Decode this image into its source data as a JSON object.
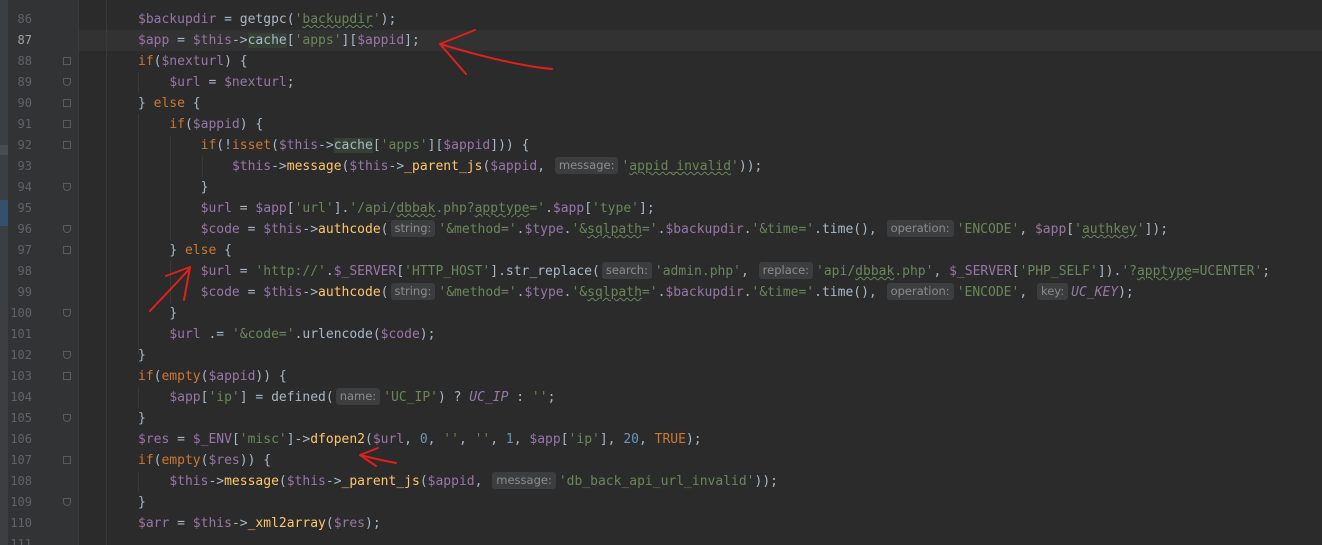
{
  "editor": {
    "current_line": "87",
    "lines": [
      {
        "num": "86",
        "segments": [
          [
            "v",
            "$backupdir"
          ],
          [
            "p",
            " = getgpc("
          ],
          [
            "s",
            "'"
          ],
          [
            "s typo",
            "backupdir"
          ],
          [
            "s",
            "'"
          ],
          [
            "p",
            ");"
          ]
        ]
      },
      {
        "num": "87",
        "segments": [
          [
            "v",
            "$app"
          ],
          [
            "p",
            " = "
          ],
          [
            "v",
            "$this"
          ],
          [
            "p",
            "->"
          ],
          [
            "p hl",
            "cache"
          ],
          [
            "p",
            "["
          ],
          [
            "s",
            "'apps'"
          ],
          [
            "p",
            "]["
          ],
          [
            "v",
            "$appid"
          ],
          [
            "p",
            "];"
          ]
        ]
      },
      {
        "num": "88",
        "segments": [
          [
            "k",
            "if"
          ],
          [
            "p",
            "("
          ],
          [
            "v",
            "$nexturl"
          ],
          [
            "p",
            ") {"
          ]
        ]
      },
      {
        "num": "89",
        "segments": [
          [
            "v",
            "$url"
          ],
          [
            "p",
            " = "
          ],
          [
            "v",
            "$nexturl"
          ],
          [
            "p",
            ";"
          ]
        ]
      },
      {
        "num": "90",
        "segments": [
          [
            "p",
            "} "
          ],
          [
            "k",
            "else"
          ],
          [
            "p",
            " {"
          ]
        ]
      },
      {
        "num": "91",
        "segments": [
          [
            "k",
            "if"
          ],
          [
            "p",
            "("
          ],
          [
            "v",
            "$appid"
          ],
          [
            "p",
            ") {"
          ]
        ]
      },
      {
        "num": "92",
        "segments": [
          [
            "k",
            "if"
          ],
          [
            "p",
            "(!"
          ],
          [
            "k",
            "isset"
          ],
          [
            "p",
            "("
          ],
          [
            "v",
            "$this"
          ],
          [
            "p",
            "->"
          ],
          [
            "p hl",
            "cache"
          ],
          [
            "p",
            "["
          ],
          [
            "s",
            "'apps'"
          ],
          [
            "p",
            "]["
          ],
          [
            "v",
            "$appid"
          ],
          [
            "p",
            "])) {"
          ]
        ]
      },
      {
        "num": "93",
        "segments": [
          [
            "v",
            "$this"
          ],
          [
            "p",
            "->"
          ],
          [
            "f",
            "message"
          ],
          [
            "p",
            "("
          ],
          [
            "v",
            "$this"
          ],
          [
            "p",
            "->"
          ],
          [
            "f",
            "_parent_js"
          ],
          [
            "p",
            "("
          ],
          [
            "v",
            "$appid"
          ],
          [
            "p",
            ", "
          ],
          [
            "hint",
            "message:"
          ],
          [
            "s",
            "'"
          ],
          [
            "s typo",
            "appid_invalid"
          ],
          [
            "s",
            "'"
          ],
          [
            "p",
            "));"
          ]
        ]
      },
      {
        "num": "94",
        "segments": [
          [
            "p",
            "}"
          ]
        ]
      },
      {
        "num": "95",
        "segments": [
          [
            "v",
            "$url"
          ],
          [
            "p",
            " = "
          ],
          [
            "v",
            "$app"
          ],
          [
            "p",
            "["
          ],
          [
            "s",
            "'url'"
          ],
          [
            "p",
            "]."
          ],
          [
            "s",
            "'/api/"
          ],
          [
            "s typo",
            "dbbak"
          ],
          [
            "s",
            ".php?"
          ],
          [
            "s typo",
            "apptype"
          ],
          [
            "s",
            "='"
          ],
          [
            "p",
            "."
          ],
          [
            "v",
            "$app"
          ],
          [
            "p",
            "["
          ],
          [
            "s",
            "'type'"
          ],
          [
            "p",
            "];"
          ]
        ]
      },
      {
        "num": "96",
        "segments": [
          [
            "v",
            "$code"
          ],
          [
            "p",
            " = "
          ],
          [
            "v",
            "$this"
          ],
          [
            "p",
            "->"
          ],
          [
            "f",
            "authcode"
          ],
          [
            "p",
            "("
          ],
          [
            "hint",
            "string:"
          ],
          [
            "s",
            "'&method='"
          ],
          [
            "p",
            "."
          ],
          [
            "v",
            "$type"
          ],
          [
            "p",
            "."
          ],
          [
            "s",
            "'&"
          ],
          [
            "s typo",
            "sqlpath"
          ],
          [
            "s",
            "='"
          ],
          [
            "p",
            "."
          ],
          [
            "v",
            "$backupdir"
          ],
          [
            "p",
            "."
          ],
          [
            "s",
            "'&time='"
          ],
          [
            "p",
            ".time(), "
          ],
          [
            "hint",
            "operation:"
          ],
          [
            "s",
            "'ENCODE'"
          ],
          [
            "p",
            ", "
          ],
          [
            "v",
            "$app"
          ],
          [
            "p",
            "["
          ],
          [
            "s",
            "'"
          ],
          [
            "s typo",
            "authkey"
          ],
          [
            "s",
            "'"
          ],
          [
            "p",
            "]);"
          ]
        ]
      },
      {
        "num": "97",
        "segments": [
          [
            "p",
            "} "
          ],
          [
            "k",
            "else"
          ],
          [
            "p",
            " {"
          ]
        ]
      },
      {
        "num": "98",
        "segments": [
          [
            "v",
            "$url"
          ],
          [
            "p",
            " = "
          ],
          [
            "s",
            "'http://'"
          ],
          [
            "p",
            "."
          ],
          [
            "v",
            "$_SERVER"
          ],
          [
            "p",
            "["
          ],
          [
            "s",
            "'HTTP_HOST'"
          ],
          [
            "p",
            "].str_replace("
          ],
          [
            "hint",
            "search:"
          ],
          [
            "s",
            "'admin.php'"
          ],
          [
            "p",
            ", "
          ],
          [
            "hint",
            "replace:"
          ],
          [
            "s",
            "'api/"
          ],
          [
            "s typo",
            "dbbak"
          ],
          [
            "s",
            ".php'"
          ],
          [
            "p",
            ", "
          ],
          [
            "v",
            "$_SERVER"
          ],
          [
            "p",
            "["
          ],
          [
            "s",
            "'PHP_SELF'"
          ],
          [
            "p",
            "])."
          ],
          [
            "s",
            "'?"
          ],
          [
            "s typo",
            "apptype"
          ],
          [
            "s",
            "=UCENTER'"
          ],
          [
            "p",
            ";"
          ]
        ]
      },
      {
        "num": "99",
        "segments": [
          [
            "v",
            "$code"
          ],
          [
            "p",
            " = "
          ],
          [
            "v",
            "$this"
          ],
          [
            "p",
            "->"
          ],
          [
            "f",
            "authcode"
          ],
          [
            "p",
            "("
          ],
          [
            "hint",
            "string:"
          ],
          [
            "s",
            "'&method='"
          ],
          [
            "p",
            "."
          ],
          [
            "v",
            "$type"
          ],
          [
            "p",
            "."
          ],
          [
            "s",
            "'&"
          ],
          [
            "s typo",
            "sqlpath"
          ],
          [
            "s",
            "='"
          ],
          [
            "p",
            "."
          ],
          [
            "v",
            "$backupdir"
          ],
          [
            "p",
            "."
          ],
          [
            "s",
            "'&time='"
          ],
          [
            "p",
            ".time(), "
          ],
          [
            "hint",
            "operation:"
          ],
          [
            "s",
            "'ENCODE'"
          ],
          [
            "p",
            ", "
          ],
          [
            "hint",
            "key:"
          ],
          [
            "c",
            "UC_KEY"
          ],
          [
            "p",
            ");"
          ]
        ]
      },
      {
        "num": "100",
        "segments": [
          [
            "p",
            "}"
          ]
        ]
      },
      {
        "num": "101",
        "segments": [
          [
            "v",
            "$url"
          ],
          [
            "p",
            " .= "
          ],
          [
            "s",
            "'&code='"
          ],
          [
            "p",
            ".urlencode("
          ],
          [
            "v",
            "$code"
          ],
          [
            "p",
            ");"
          ]
        ]
      },
      {
        "num": "102",
        "segments": [
          [
            "p",
            "}"
          ]
        ]
      },
      {
        "num": "103",
        "segments": [
          [
            "k",
            "if"
          ],
          [
            "p",
            "("
          ],
          [
            "k",
            "empty"
          ],
          [
            "p",
            "("
          ],
          [
            "v",
            "$appid"
          ],
          [
            "p",
            ")) {"
          ]
        ]
      },
      {
        "num": "104",
        "segments": [
          [
            "v",
            "$app"
          ],
          [
            "p",
            "["
          ],
          [
            "s",
            "'ip'"
          ],
          [
            "p",
            "] = defined("
          ],
          [
            "hint",
            "name:"
          ],
          [
            "s",
            "'UC_IP'"
          ],
          [
            "p",
            ") ? "
          ],
          [
            "c",
            "UC_IP"
          ],
          [
            "p",
            " : "
          ],
          [
            "s",
            "''"
          ],
          [
            "p",
            ";"
          ]
        ]
      },
      {
        "num": "105",
        "segments": [
          [
            "p",
            "}"
          ]
        ]
      },
      {
        "num": "106",
        "segments": [
          [
            "v",
            "$res"
          ],
          [
            "p",
            " = "
          ],
          [
            "v",
            "$_ENV"
          ],
          [
            "p",
            "["
          ],
          [
            "s",
            "'misc'"
          ],
          [
            "p",
            "]->"
          ],
          [
            "f",
            "dfopen2"
          ],
          [
            "p",
            "("
          ],
          [
            "v",
            "$url"
          ],
          [
            "p",
            ", "
          ],
          [
            "n",
            "0"
          ],
          [
            "p",
            ", "
          ],
          [
            "s",
            "''"
          ],
          [
            "p",
            ", "
          ],
          [
            "s",
            "''"
          ],
          [
            "p",
            ", "
          ],
          [
            "n",
            "1"
          ],
          [
            "p",
            ", "
          ],
          [
            "v",
            "$app"
          ],
          [
            "p",
            "["
          ],
          [
            "s",
            "'ip'"
          ],
          [
            "p",
            "], "
          ],
          [
            "n",
            "20"
          ],
          [
            "p",
            ", "
          ],
          [
            "k",
            "TRUE"
          ],
          [
            "p",
            ");"
          ]
        ]
      },
      {
        "num": "107",
        "segments": [
          [
            "k",
            "if"
          ],
          [
            "p",
            "("
          ],
          [
            "k",
            "empty"
          ],
          [
            "p",
            "("
          ],
          [
            "v",
            "$res"
          ],
          [
            "p",
            ")) {"
          ]
        ]
      },
      {
        "num": "108",
        "segments": [
          [
            "v",
            "$this"
          ],
          [
            "p",
            "->"
          ],
          [
            "f",
            "message"
          ],
          [
            "p",
            "("
          ],
          [
            "v",
            "$this"
          ],
          [
            "p",
            "->"
          ],
          [
            "f",
            "_parent_js"
          ],
          [
            "p",
            "("
          ],
          [
            "v",
            "$appid"
          ],
          [
            "p",
            ", "
          ],
          [
            "hint",
            "message:"
          ],
          [
            "s",
            "'db_back_api_url_invalid'"
          ],
          [
            "p",
            "));"
          ]
        ]
      },
      {
        "num": "109",
        "segments": [
          [
            "p",
            "}"
          ]
        ]
      },
      {
        "num": "110",
        "segments": [
          [
            "v",
            "$arr"
          ],
          [
            "p",
            " = "
          ],
          [
            "v",
            "$this"
          ],
          [
            "p",
            "->"
          ],
          [
            "f",
            "_xml2array"
          ],
          [
            "p",
            "("
          ],
          [
            "v",
            "$res"
          ],
          [
            "p",
            ");"
          ]
        ]
      },
      {
        "num": "111",
        "segments": []
      }
    ]
  },
  "colors": {
    "background": "#2b2b2b",
    "gutter": "#313335",
    "variable": "#9876aa",
    "keyword": "#cc7832",
    "string": "#6a8759",
    "function": "#ffc66d",
    "annotation_ink": "#e0201a"
  },
  "annotations": [
    {
      "name": "arrow-to-line-87",
      "description_icon": "red-arrow-icon"
    },
    {
      "name": "arrow-to-else-line-97",
      "description_icon": "red-arrow-icon"
    },
    {
      "name": "arrow-to-dfopen2-line-106",
      "description_icon": "red-arrow-icon"
    }
  ]
}
